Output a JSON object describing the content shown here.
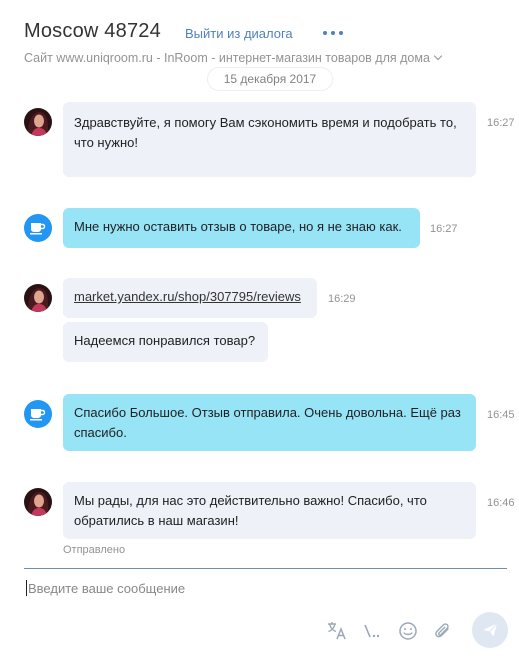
{
  "header": {
    "title": "Moscow 48724",
    "exit_label": "Выйти из диалога",
    "subtitle": "Сайт www.uniqroom.ru - InRoom - интернет-магазин товаров для дома",
    "date": "15 декабря 2017"
  },
  "messages": [
    {
      "sender": "operator",
      "text": "Здравствуйте, я помогу Вам сэкономить время и подобрать то, что нужно!",
      "time": "16:27"
    },
    {
      "sender": "client",
      "text": "Мне нужно оставить отзыв о товаре, но я не знаю как.",
      "time": "16:27"
    },
    {
      "sender": "operator",
      "text": "market.yandex.ru/shop/307795/reviews",
      "time": "16:29"
    },
    {
      "sender": "operator",
      "text": "Надеемся понравился товар?",
      "time": ""
    },
    {
      "sender": "client",
      "text": "Спасибо Большое. Отзыв отправила. Очень довольна. Ещё раз спасибо.",
      "time": "16:45"
    },
    {
      "sender": "operator",
      "text": "Мы рады, для нас это действительно важно! Спасибо, что обратились в наш магазин!",
      "time": "16:46"
    }
  ],
  "status": "Отправлено",
  "composer": {
    "placeholder": "Введите ваше сообщение"
  },
  "icons": [
    "more-icon",
    "chevron-down-icon",
    "coffee-cup-icon",
    "translate-icon",
    "quick-replies-icon",
    "emoji-icon",
    "attach-icon",
    "send-icon"
  ],
  "colors": {
    "link": "#5181b8",
    "client_bubble": "#97e4f7",
    "operator_bubble": "#eef1f8",
    "bot_avatar": "#2196f3"
  }
}
